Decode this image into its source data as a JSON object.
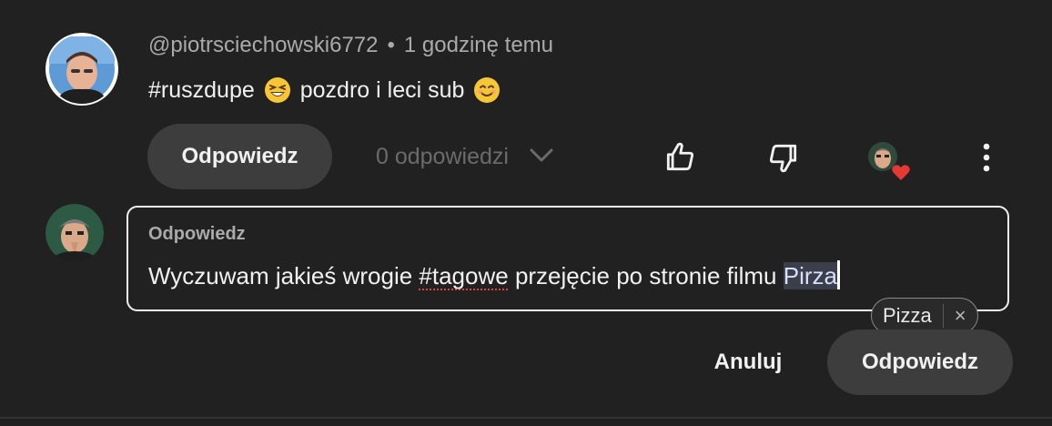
{
  "comment": {
    "author": "@piotrsciechowski6772",
    "separator": "•",
    "time": "1 godzinę temu",
    "text_part1": "#ruszdupe",
    "emoji1": "laughing-face-emoji",
    "text_part2": "pozdro i leci sub",
    "emoji2": "smiling-face-emoji"
  },
  "actions": {
    "reply_label": "Odpowiedz",
    "replies_count": "0 odpowiedzi",
    "like_icon": "thumbs-up-icon",
    "dislike_icon": "thumbs-down-icon",
    "creator_heart": "creator-heart-avatar",
    "more_icon": "more-vertical-icon"
  },
  "reply_box": {
    "label": "Odpowiedz",
    "text_before": "Wyczuwam jakieś wrogie ",
    "text_misspelled": "#tagowe",
    "text_middle": " przejęcie po stronie filmu ",
    "text_selected": "Pirza"
  },
  "suggestion": {
    "word": "Pizza",
    "close": "×"
  },
  "buttons": {
    "cancel": "Anuluj",
    "submit": "Odpowiedz"
  },
  "colors": {
    "background": "#212121",
    "pill": "#3d3d3d",
    "heart": "#e53935"
  }
}
